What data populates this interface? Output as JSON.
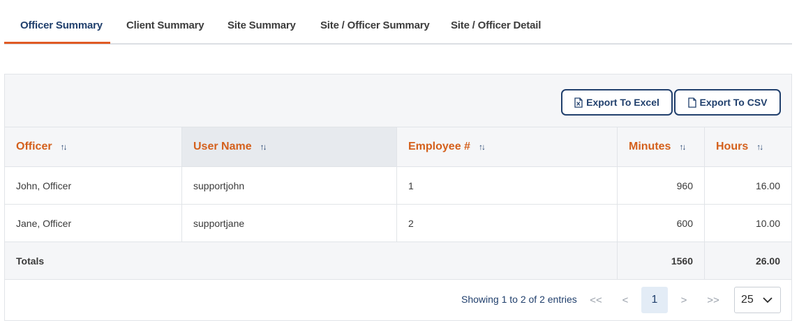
{
  "tabs": [
    {
      "label": "Officer Summary",
      "active": true
    },
    {
      "label": "Client Summary",
      "active": false
    },
    {
      "label": "Site Summary",
      "active": false
    },
    {
      "label": "Site / Officer Summary",
      "active": false
    },
    {
      "label": "Site / Officer Detail",
      "active": false
    }
  ],
  "toolbar": {
    "export_excel_label": "Export To Excel",
    "export_csv_label": "Export To CSV"
  },
  "table": {
    "columns": [
      {
        "label": "Officer",
        "icon": "sort-icon"
      },
      {
        "label": "User Name",
        "icon": "sort-icon",
        "sorted": true
      },
      {
        "label": "Employee #",
        "icon": "sort-icon"
      },
      {
        "label": "Minutes",
        "icon": "sort-icon"
      },
      {
        "label": "Hours",
        "icon": "sort-icon"
      }
    ],
    "rows": [
      {
        "officer": "John, Officer",
        "username": "supportjohn",
        "employee": "1",
        "minutes": "960",
        "hours": "16.00"
      },
      {
        "officer": "Jane, Officer",
        "username": "supportjane",
        "employee": "2",
        "minutes": "600",
        "hours": "10.00"
      }
    ],
    "totals": {
      "label": "Totals",
      "minutes": "1560",
      "hours": "26.00"
    }
  },
  "pagination": {
    "showing_text": "Showing 1 to 2 of 2 entries",
    "first": "<<",
    "prev": "<",
    "current_page": "1",
    "next": ">",
    "last": ">>",
    "page_size": "25"
  },
  "colors": {
    "accent": "#e05a24",
    "header_text": "#d4601c",
    "primary": "#21406d"
  }
}
